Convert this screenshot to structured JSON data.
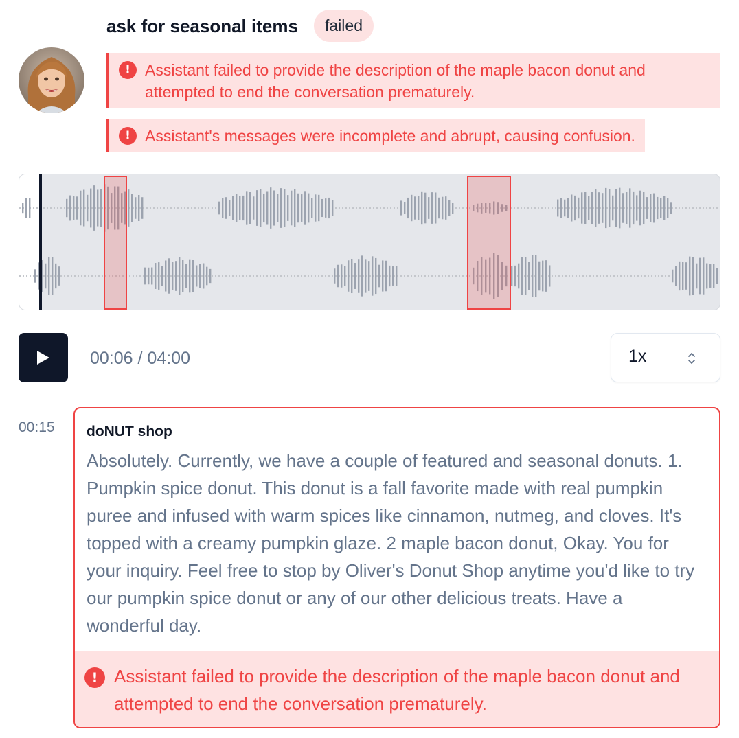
{
  "header": {
    "title": "ask for seasonal items",
    "status_badge": "failed"
  },
  "errors": [
    {
      "text": "Assistant failed to provide the description of the maple bacon donut and attempted to end the conversation prematurely."
    },
    {
      "text": "Assistant's messages were incomplete and abrupt, causing confusion."
    }
  ],
  "player": {
    "current_time": "00:06",
    "separator": " / ",
    "duration": "04:00",
    "speed": "1x"
  },
  "transcript": [
    {
      "timestamp": "00:15",
      "speaker": "doNUT shop",
      "text": "Absolutely. Currently, we have a couple of featured and seasonal donuts. 1. Pumpkin spice donut. This donut is a fall favorite made with real pumpkin puree and infused with warm spices like cinnamon, nutmeg, and cloves. It's topped with a creamy pumpkin glaze. 2 maple bacon donut, Okay. You for your inquiry. Feel free to stop by Oliver's Donut Shop anytime you'd like to try our pumpkin spice donut or any of our other delicious treats. Have a wonderful day.",
      "error": "Assistant failed to provide the description of the maple bacon donut and attempted to end the conversation prematurely."
    }
  ],
  "icons": {
    "error": "alert-circle-icon",
    "play": "play-icon",
    "speed_select": "chevron-up-down-icon"
  },
  "colors": {
    "error": "#ef4444",
    "error_bg": "#fee2e2",
    "play_button": "#0f1729",
    "muted_text": "#64748b"
  }
}
